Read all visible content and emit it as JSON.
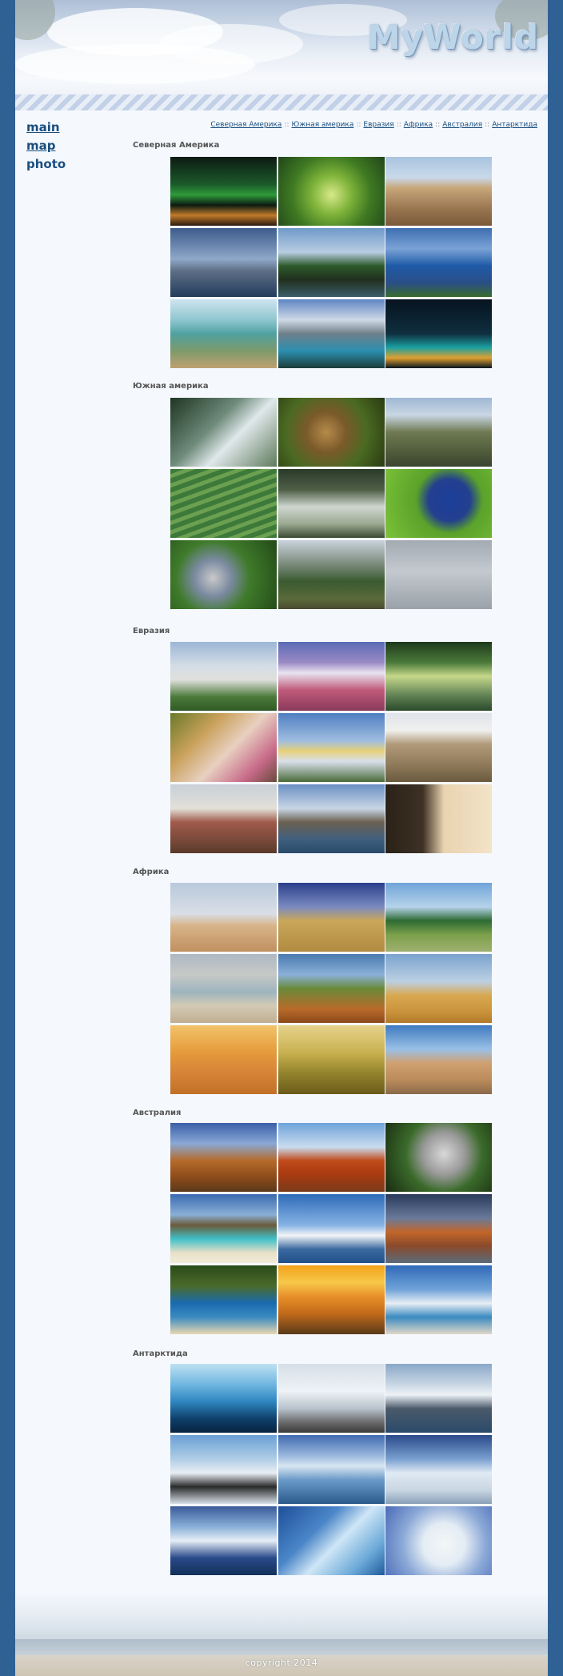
{
  "site": {
    "logo": "MyWorld",
    "copyright": "copyright 2014"
  },
  "left_nav": [
    {
      "label": "main"
    },
    {
      "label": "map"
    },
    {
      "label": "photo"
    }
  ],
  "top_nav": [
    {
      "label": "Северная Америка"
    },
    {
      "label": "Южная америка"
    },
    {
      "label": "Евразия"
    },
    {
      "label": "Африка"
    },
    {
      "label": "Австралия"
    },
    {
      "label": "Антарктида"
    }
  ],
  "top_nav_separator": "::",
  "sections": [
    {
      "title": "Северная Америка"
    },
    {
      "title": "Южная америка"
    },
    {
      "title": "Евразия"
    },
    {
      "title": "Африка"
    },
    {
      "title": "Австралия"
    },
    {
      "title": "Антарктида"
    }
  ],
  "colors": {
    "frame": "#2f6195",
    "page_bg": "#f5f8fd",
    "link": "#1a4f80"
  }
}
